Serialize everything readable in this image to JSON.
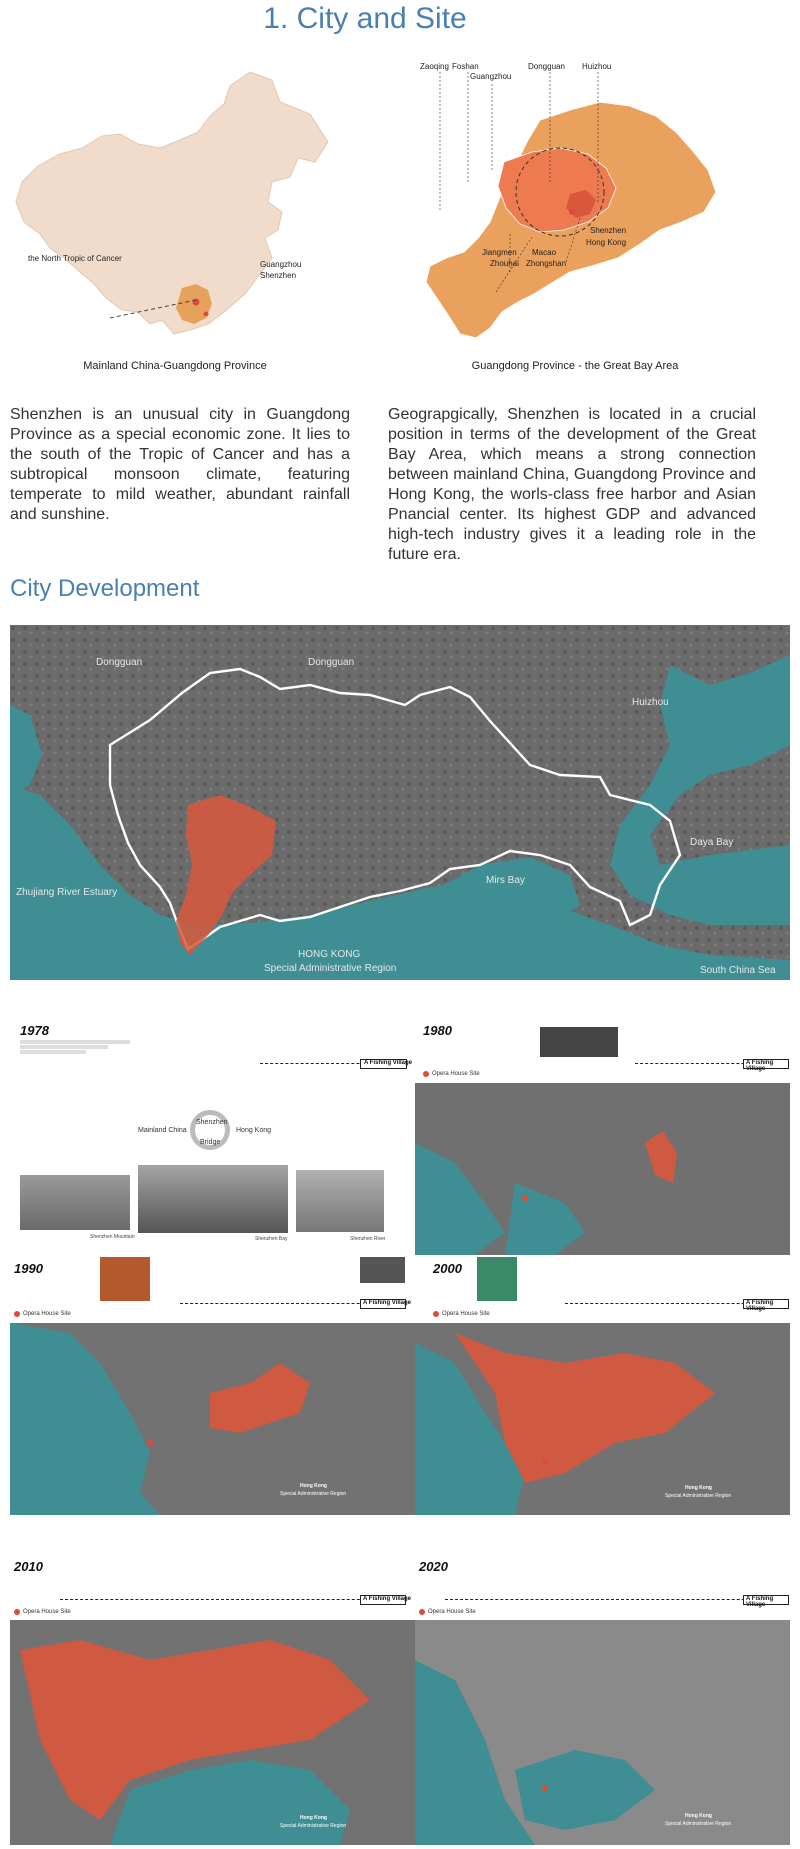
{
  "title": "1. City and Site",
  "map_left": {
    "caption": "Mainland China-Guangdong Province",
    "label_tropic": "the North Tropic of Cancer",
    "label_guangzhou": "Guangzhou",
    "label_shenzhen": "Shenzhen"
  },
  "map_right": {
    "caption": "Guangdong Province - the Great Bay Area",
    "labels": {
      "zaoqing": "Zaoqing",
      "foshan": "Foshan",
      "guangzhou": "Guangzhou",
      "dongguan": "Dongguan",
      "huizhou": "Huizhou",
      "shenzhen": "Shenzhen",
      "hongkong": "Hong Kong",
      "jiangmen": "Jiangmen",
      "macao": "Macao",
      "zhouhai": "Zhouhai",
      "zhongshan": "Zhongshan"
    }
  },
  "para_left": "Shenzhen is an unusual city in Guangdong Province as a special economic zone. It lies to the south of the Tropic of Cancer and has a subtropical monsoon climate, featuring temperate to mild weather, abundant rainfall and sunshine.",
  "para_right": "Geograpgically, Shenzhen is located in a crucial position in terms of the development of the Great Bay Area, which means a strong connection between mainland China, Guangdong Province and Hong Kong, the worls-class free harbor and Asian Pnancial center. Its highest GDP and advanced high-tech industry gives it a leading role in the future era.",
  "subtitle": "City Development",
  "aerial": {
    "dongguan_left": "Dongguan",
    "dongguan_right": "Dongguan",
    "huizhou": "Huizhou",
    "zhujiang": "Zhujiang River Estuary",
    "daya_bay": "Daya Bay",
    "mirs_bay": "Mirs Bay",
    "hong_kong": "HONG KONG",
    "sar": "Special Administrative Region",
    "south_china_sea": "South China Sea"
  },
  "panels": {
    "p1978": {
      "year": "1978",
      "tl_label": "A Fishing Village",
      "photo_captions": [
        "Shenzhen Mountain",
        "Shenzhen Bay",
        "Shenzhen River"
      ],
      "diagram_left": "Mainland China",
      "diagram_right": "Hong Kong",
      "diagram_top": "Shenzhen",
      "diagram_bottom": "Bridge"
    },
    "p1980": {
      "year": "1980",
      "tl_label": "A Fishing Village",
      "legend": "Opera House Site"
    },
    "p1990": {
      "year": "1990",
      "tl_label": "A Fishing Village",
      "legend": "Opera House Site",
      "hk": "Hong Kong",
      "sar": "Special Administrative Region"
    },
    "p2000": {
      "year": "2000",
      "tl_label": "A Fishing Village",
      "legend": "Opera House Site",
      "hk": "Hong Kong",
      "sar": "Special Administrative Region"
    },
    "p2010": {
      "year": "2010",
      "tl_label": "A Fishing Village",
      "legend": "Opera House Site",
      "hk": "Hong Kong",
      "sar": "Special Administrative Region"
    },
    "p2020": {
      "year": "2020",
      "tl_label": "A Fishing Village",
      "legend": "Opera House Site",
      "hk": "Hong Kong",
      "sar": "Special Administrative Region"
    }
  },
  "colors": {
    "accent_blue": "#4a7fb3",
    "urban_red": "#d9573c",
    "china_beige": "#f1dccb",
    "gba_orange": "#eaa15d",
    "gba_dark": "#ee7a50",
    "sea_teal": "#3e8e93"
  }
}
